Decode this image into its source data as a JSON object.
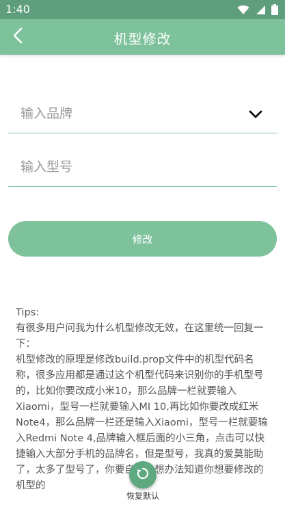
{
  "status_bar": {
    "time": "1:40",
    "icons": [
      "wifi-icon",
      "signal-icon",
      "battery-icon"
    ]
  },
  "app_bar": {
    "title": "机型修改",
    "back_icon": "back-arrow-icon"
  },
  "form": {
    "brand_placeholder": "输入品牌",
    "brand_value": "",
    "model_placeholder": "输入型号",
    "model_value": "",
    "dropdown_icon": "chevron-down-icon",
    "submit_label": "修改"
  },
  "tips": {
    "heading": "Tips:",
    "paragraphs": [
      "有很多用户问我为什么机型修改无效，在这里统一回复一下：",
      "机型修改的原理是修改build.prop文件中的机型代码名称，很多应用都是通过这个机型代码来识别你的手机型号的，比如你要改成小米10，那么品牌一栏就要输入Xiaomi，型号一栏就要输入MI 10,再比如你要改成红米Note4，那么品牌一栏还是输入Xiaomi，型号一栏就要输入Redmi Note 4,品牌输入框后面的小三角，点击可以快捷输入大部分手机的品牌名，但是型号，我真的爱莫能助了，太多了型号了，你要自己去想办法知道你想要修改的机型的"
    ]
  },
  "fab": {
    "icon": "restore-icon",
    "label": "恢复默认"
  },
  "colors": {
    "status_bar": "#5e9e7d",
    "accent": "#7dc29b",
    "fab": "#5ea97f",
    "tips_text": "#555555"
  }
}
